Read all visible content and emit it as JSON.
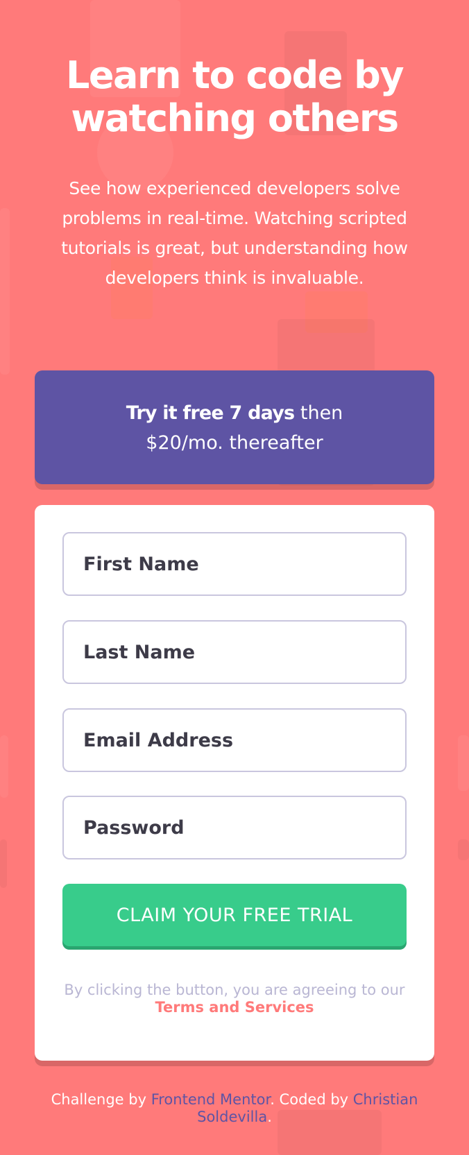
{
  "hero": {
    "title": "Learn to code by watching others",
    "description": "See how experienced developers solve problems in real-time. Watching scripted tutorials is great, but understanding how developers think is invaluable."
  },
  "promo": {
    "bold_text": "Try it free 7 days",
    "rest_line1": " then",
    "rest_line2": "$20/mo. thereafter"
  },
  "form": {
    "first_name_placeholder": "First Name",
    "last_name_placeholder": "Last Name",
    "email_placeholder": "Email Address",
    "password_placeholder": "Password",
    "first_name_value": "",
    "last_name_value": "",
    "email_value": "",
    "password_value": "",
    "submit_label": "CLAIM YOUR FREE TRIAL",
    "terms_prefix": "By clicking the button, you are agreeing to our",
    "terms_link": "Terms and Services"
  },
  "footer": {
    "challenge_prefix": "Challenge by ",
    "challenge_link": "Frontend Mentor",
    "coded_prefix": ". Coded by ",
    "author_link": "Christian Soldevilla",
    "suffix": "."
  },
  "colors": {
    "background": "#ff7a7a",
    "promo": "#5e54a4",
    "cta": "#38cc8b",
    "field_border": "#c9c6de",
    "text_dark": "#3d3b48",
    "terms_gray": "#b9b6d3"
  }
}
